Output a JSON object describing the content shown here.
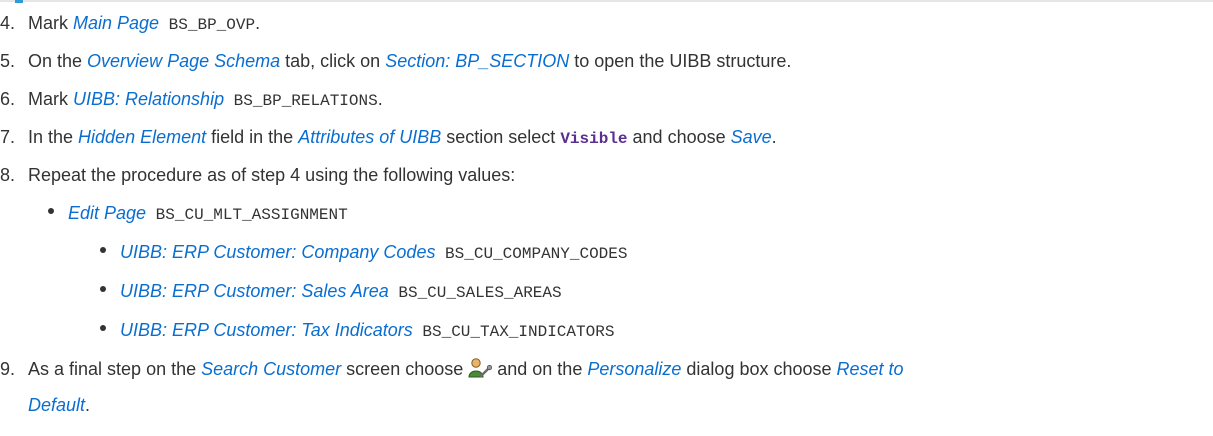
{
  "steps": [
    {
      "num": "4.",
      "t1": "Mark ",
      "l1": "Main Page",
      "c1": " BS_BP_OVP",
      "t2": "."
    },
    {
      "num": "5.",
      "t1": "On the ",
      "l1": "Overview Page Schema",
      "t2": " tab, click on ",
      "l2": "Section: BP_SECTION",
      "t3": " to open the UIBB structure."
    },
    {
      "num": "6.",
      "t1": "Mark ",
      "l1": "UIBB: Relationship",
      "c1": " BS_BP_RELATIONS",
      "t2": "."
    },
    {
      "num": "7.",
      "t1": "In the ",
      "l1": "Hidden Element",
      "t2": " field in the ",
      "l2": "Attributes of UIBB",
      "t3": " section select ",
      "k1": "Visible",
      "t4": " and choose ",
      "l3": "Save",
      "t5": "."
    },
    {
      "num": "8.",
      "t1": "Repeat the procedure as of step 4 using the following values:"
    },
    {
      "num": "9.",
      "t1": "As a final step on the ",
      "l1": "Search Customer",
      "t2": " screen choose ",
      "t3": " and on the ",
      "l2": "Personalize",
      "t4": " dialog box choose ",
      "l3": "Reset to",
      "l4": "Default",
      "t5": "."
    }
  ],
  "bullets": {
    "edit_page": {
      "label": "Edit Page",
      "code": " BS_CU_MLT_ASSIGNMENT"
    },
    "sub": [
      {
        "label": "UIBB: ERP Customer: Company Codes",
        "code": " BS_CU_COMPANY_CODES"
      },
      {
        "label": "UIBB: ERP Customer: Sales Area",
        "code": " BS_CU_SALES_AREAS"
      },
      {
        "label": "UIBB: ERP Customer: Tax Indicators",
        "code": " BS_CU_TAX_INDICATORS"
      }
    ]
  },
  "icons": {
    "personalize": "personalize-icon"
  },
  "colors": {
    "link": "#0a6ed1",
    "keyword": "#5b2f91",
    "text": "#333333"
  }
}
